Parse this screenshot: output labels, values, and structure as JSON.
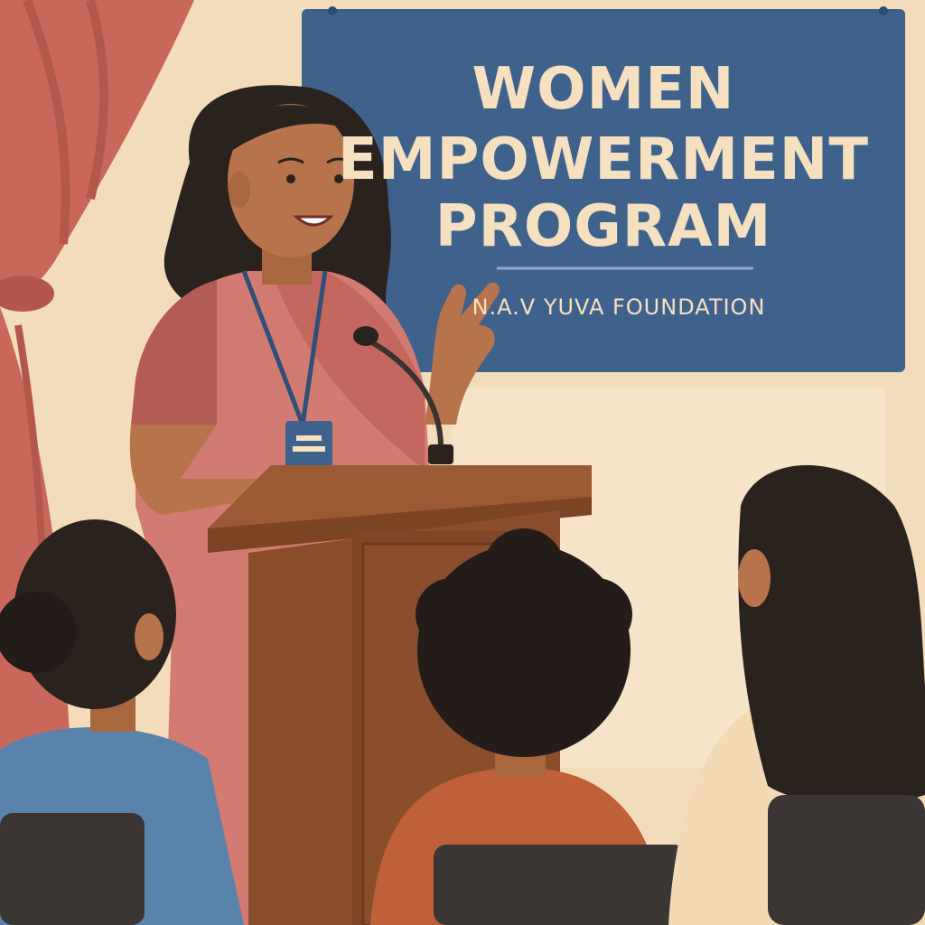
{
  "banner": {
    "title_lines": [
      "WOMEN",
      "EMPOWERMENT",
      "PROGRAM"
    ],
    "subtitle": "N.A.V YUVA FOUNDATION"
  },
  "colors": {
    "wall": "#f3dcb9",
    "curtain": "#c9685a",
    "banner": "#3f628c",
    "banner_text": "#f5e0c0",
    "saree": "#d27b72",
    "podium": "#8b4e2c",
    "skin": "#b7744c",
    "hair": "#2a221d"
  },
  "icons": [
    "microphone-icon",
    "id-badge-icon"
  ]
}
